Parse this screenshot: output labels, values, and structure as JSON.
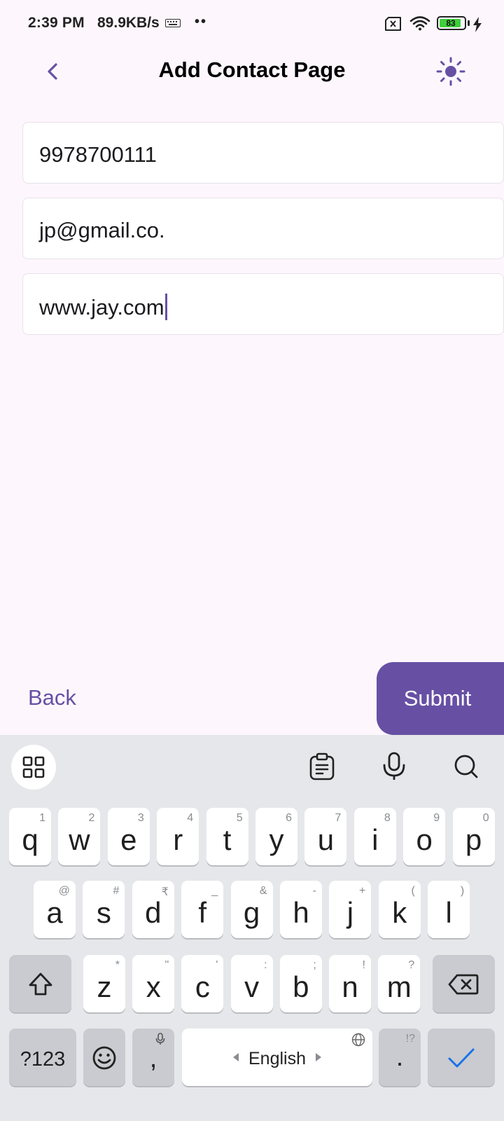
{
  "status_bar": {
    "time": "2:39 PM",
    "net_speed": "89.9KB/s",
    "dots": "••",
    "battery_level": "83"
  },
  "app_bar": {
    "title": "Add Contact Page"
  },
  "form": {
    "phone_value": "9978700111",
    "email_value": "jp@gmail.co.",
    "website_value": "www.jay.com"
  },
  "actions": {
    "back_label": "Back",
    "submit_label": "Submit"
  },
  "keyboard": {
    "row1": [
      {
        "main": "q",
        "sub": "1"
      },
      {
        "main": "w",
        "sub": "2"
      },
      {
        "main": "e",
        "sub": "3"
      },
      {
        "main": "r",
        "sub": "4"
      },
      {
        "main": "t",
        "sub": "5"
      },
      {
        "main": "y",
        "sub": "6"
      },
      {
        "main": "u",
        "sub": "7"
      },
      {
        "main": "i",
        "sub": "8"
      },
      {
        "main": "o",
        "sub": "9"
      },
      {
        "main": "p",
        "sub": "0"
      }
    ],
    "row2": [
      {
        "main": "a",
        "sub": "@"
      },
      {
        "main": "s",
        "sub": "#"
      },
      {
        "main": "d",
        "sub": "₹"
      },
      {
        "main": "f",
        "sub": "_"
      },
      {
        "main": "g",
        "sub": "&"
      },
      {
        "main": "h",
        "sub": "-"
      },
      {
        "main": "j",
        "sub": "+"
      },
      {
        "main": "k",
        "sub": "("
      },
      {
        "main": "l",
        "sub": ")"
      }
    ],
    "row3": [
      {
        "main": "z",
        "sub": "*"
      },
      {
        "main": "x",
        "sub": "\""
      },
      {
        "main": "c",
        "sub": "'"
      },
      {
        "main": "v",
        "sub": ":"
      },
      {
        "main": "b",
        "sub": ";"
      },
      {
        "main": "n",
        "sub": "!"
      },
      {
        "main": "m",
        "sub": "?"
      }
    ],
    "symbols_label": "?123",
    "comma_label": ",",
    "space_label": "English",
    "period_label": ".",
    "period_sub": "!?"
  },
  "colors": {
    "accent": "#6750a4",
    "background": "#fdf7fd",
    "keyboard_bg": "#e6e7ea",
    "battery_green": "#3fcf3a",
    "enter_key_blue": "#1a73e8"
  },
  "icons": [
    "back-arrow-icon",
    "brightness-icon",
    "keyboard-icon",
    "sim-x-icon",
    "wifi-icon",
    "battery-icon",
    "charging-bolt-icon",
    "grid-icon",
    "clipboard-icon",
    "microphone-icon",
    "search-icon",
    "shift-icon",
    "backspace-icon",
    "emoji-icon",
    "globe-icon",
    "check-icon"
  ]
}
